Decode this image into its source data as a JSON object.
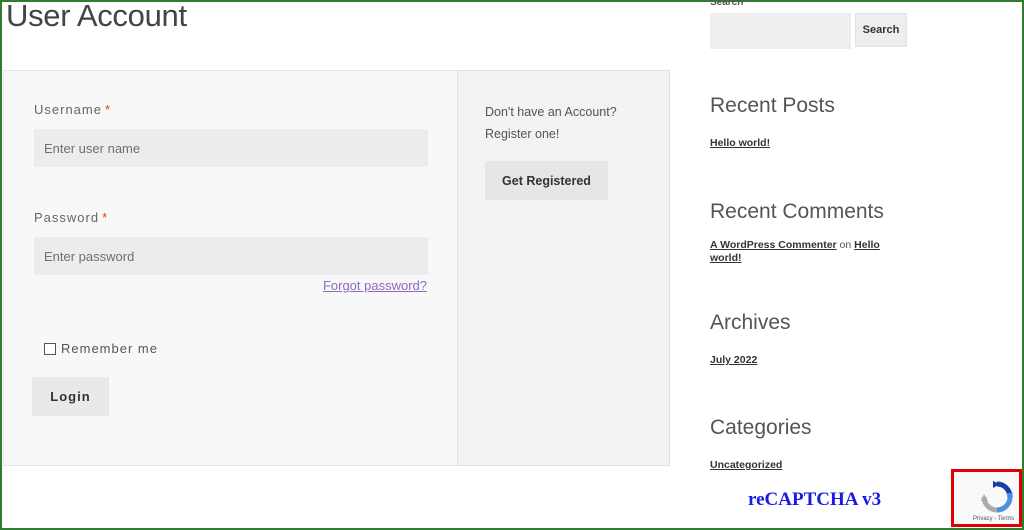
{
  "page": {
    "title": "User Account"
  },
  "login_form": {
    "username_label": "Username",
    "username_placeholder": "Enter user name",
    "password_label": "Password",
    "password_placeholder": "Enter password",
    "required_mark": "*",
    "forgot_password": "Forgot password?",
    "remember_me": "Remember me",
    "login_button": "Login"
  },
  "register": {
    "prompt_line1": "Don't have an Account?",
    "prompt_line2": "Register one!",
    "button": "Get Registered"
  },
  "sidebar": {
    "search_label": "Search",
    "search_button": "Search",
    "recent_posts_title": "Recent Posts",
    "recent_posts": [
      "Hello world!"
    ],
    "recent_comments_title": "Recent Comments",
    "comment_author": "A WordPress Commenter",
    "comment_on": "on",
    "comment_post": "Hello world!",
    "archives_title": "Archives",
    "archives": [
      "July 2022"
    ],
    "categories_title": "Categories",
    "categories": [
      "Uncategorized"
    ]
  },
  "recaptcha": {
    "caption": "reCAPTCHA v3",
    "badge_links": "Privacy - Terms"
  },
  "colors": {
    "frame_border": "#2e7d32",
    "required": "#e2401c",
    "link_purple": "#8e6bbf",
    "caption_blue": "#1a1ae6",
    "highlight_red": "#e00000"
  }
}
